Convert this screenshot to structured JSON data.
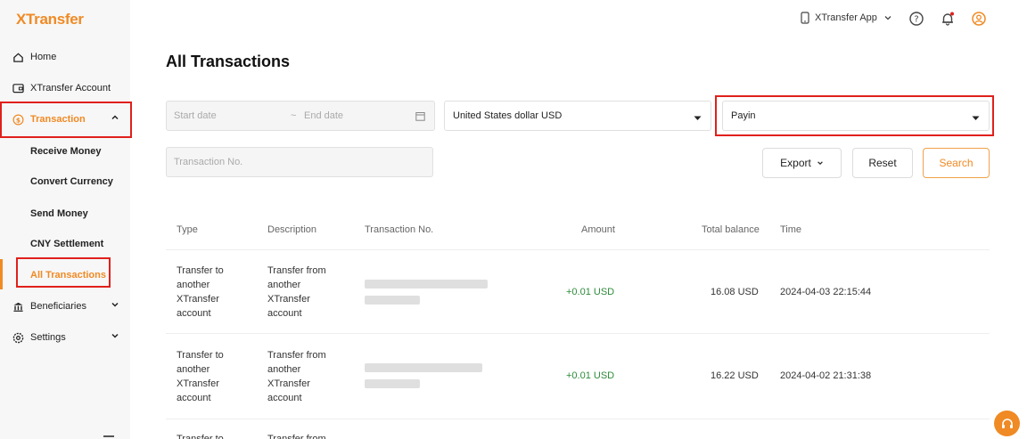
{
  "brand": {
    "name": "XTransfer",
    "accent": "#f08a24",
    "highlight": "#e0201c"
  },
  "sidebar": {
    "home": "Home",
    "account": "XTransfer Account",
    "transaction": "Transaction",
    "sub": [
      "Receive Money",
      "Convert Currency",
      "Send Money",
      "CNY Settlement",
      "All Transactions"
    ],
    "beneficiaries": "Beneficiaries",
    "settings": "Settings"
  },
  "topbar": {
    "app_label": "XTransfer App"
  },
  "page": {
    "title": "All Transactions"
  },
  "filters": {
    "start_placeholder": "Start date",
    "separator": "~",
    "end_placeholder": "End date",
    "currency": "United States dollar USD",
    "type": "Payin",
    "txn_placeholder": "Transaction No."
  },
  "buttons": {
    "export": "Export",
    "reset": "Reset",
    "search": "Search"
  },
  "table": {
    "headers": [
      "Type",
      "Description",
      "Transaction No.",
      "Amount",
      "Total balance",
      "Time"
    ],
    "rows": [
      {
        "type": [
          "Transfer to",
          "another",
          "XTransfer",
          "account"
        ],
        "desc": [
          "Transfer from",
          "another",
          "XTransfer",
          "account"
        ],
        "amount": "+0.01 USD",
        "balance": "16.08 USD",
        "time": "2024-04-03 22:15:44"
      },
      {
        "type": [
          "Transfer to",
          "another",
          "XTransfer",
          "account"
        ],
        "desc": [
          "Transfer from",
          "another",
          "XTransfer",
          "account"
        ],
        "amount": "+0.01 USD",
        "balance": "16.22 USD",
        "time": "2024-04-02 21:31:38"
      },
      {
        "type": [
          "Transfer to"
        ],
        "desc": [
          "Transfer from"
        ]
      }
    ]
  }
}
